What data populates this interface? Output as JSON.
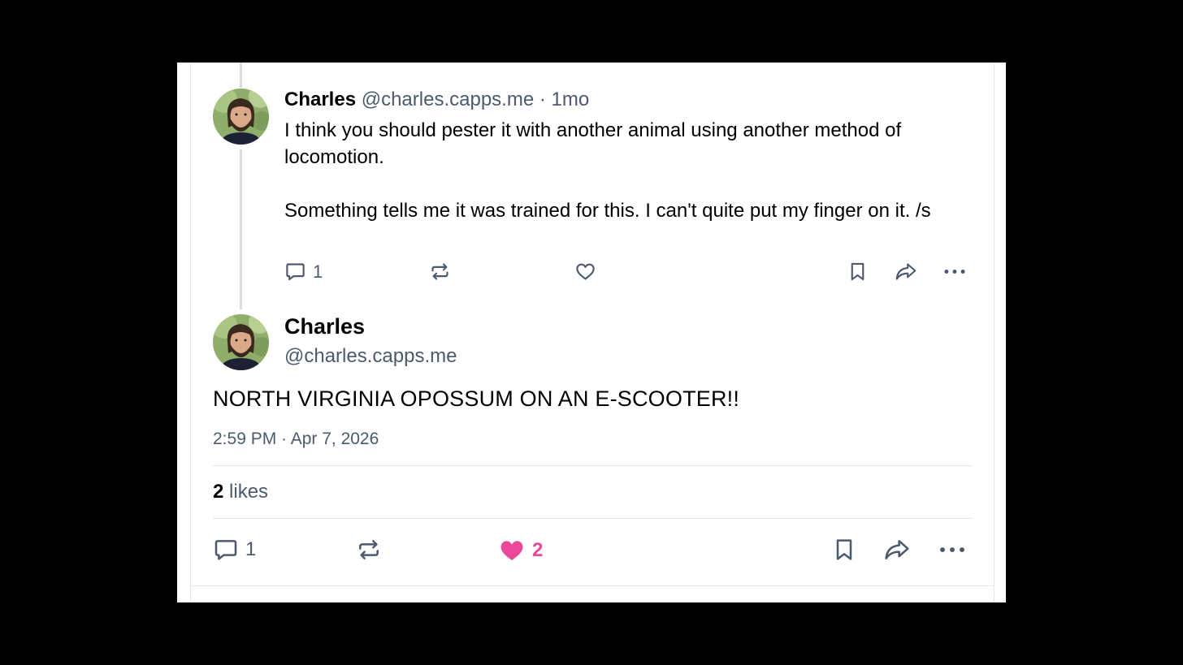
{
  "reply": {
    "author_name": "Charles",
    "handle": "@charles.capps.me",
    "separator": "·",
    "time_ago": "1mo",
    "text": "I think you should pester it with another animal using another method of locomotion.\n\nSomething tells me it was trained for this. I can't quite put my finger on it. /s",
    "reply_count": "1",
    "icons": [
      "reply-icon",
      "repost-icon",
      "like-icon",
      "bookmark-icon",
      "share-icon",
      "more-icon"
    ]
  },
  "post": {
    "author_name": "Charles",
    "handle": "@charles.capps.me",
    "text": "NORTH VIRGINIA OPOSSUM ON AN E-SCOOTER!!",
    "timestamp": "2:59 PM · Apr 7, 2026",
    "likes_count": "2",
    "likes_label": "likes",
    "reply_count": "1",
    "like_count": "2",
    "liked": true,
    "icons": [
      "reply-icon",
      "repost-icon",
      "heart-filled-icon",
      "bookmark-icon",
      "share-icon",
      "more-icon"
    ]
  },
  "colors": {
    "muted": "#4b5a6e",
    "liked": "#ec4899",
    "border": "#e3e6ea",
    "thread_line": "#d9dde1"
  }
}
